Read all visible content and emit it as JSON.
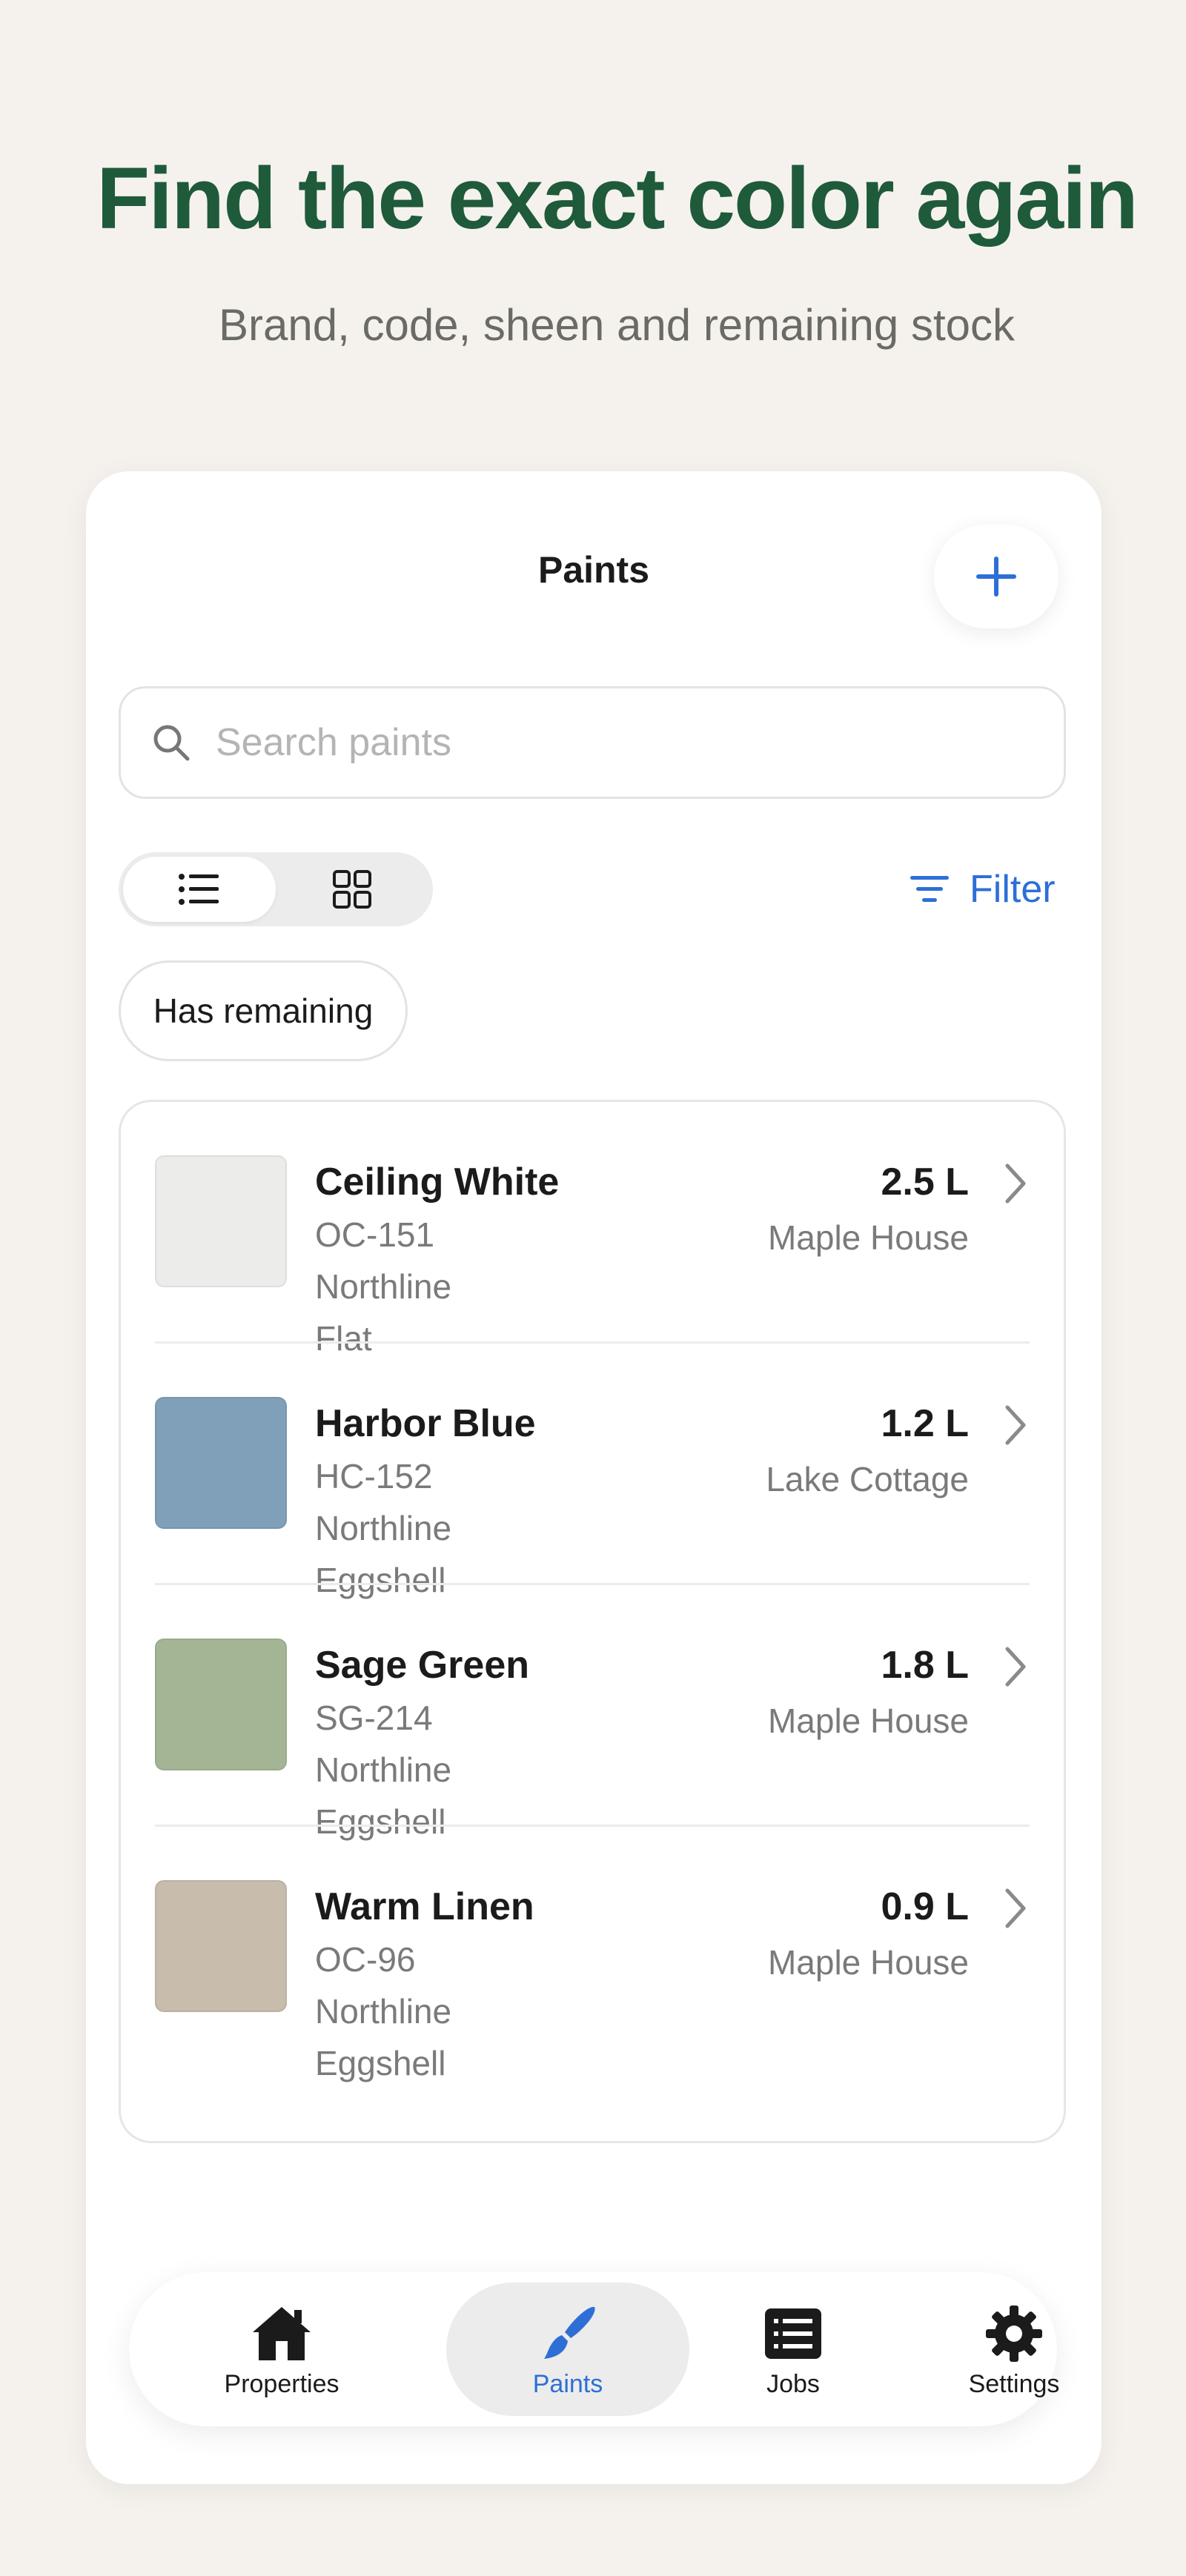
{
  "promo": {
    "headline": "Find the exact color again",
    "subhead": "Brand, code, sheen and remaining stock"
  },
  "header": {
    "title": "Paints",
    "add_icon": "plus-icon"
  },
  "search": {
    "placeholder": "Search paints",
    "value": ""
  },
  "view_toggle": {
    "options": [
      "list-view-icon",
      "grid-view-icon"
    ],
    "selected": "list-view-icon"
  },
  "filter": {
    "label": "Filter",
    "icon": "filter-lines-icon"
  },
  "chips": {
    "has_remaining": "Has remaining"
  },
  "paints": [
    {
      "name": "Ceiling White",
      "code": "OC-151",
      "brand": "Northline",
      "sheen": "Flat",
      "quantity": "2.5 L",
      "property": "Maple House",
      "swatch": "#ececea"
    },
    {
      "name": "Harbor Blue",
      "code": "HC-152",
      "brand": "Northline",
      "sheen": "Eggshell",
      "quantity": "1.2 L",
      "property": "Lake Cottage",
      "swatch": "#7fa0b8"
    },
    {
      "name": "Sage Green",
      "code": "SG-214",
      "brand": "Northline",
      "sheen": "Eggshell",
      "quantity": "1.8 L",
      "property": "Maple House",
      "swatch": "#a3b595"
    },
    {
      "name": "Warm Linen",
      "code": "OC-96",
      "brand": "Northline",
      "sheen": "Eggshell",
      "quantity": "0.9 L",
      "property": "Maple House",
      "swatch": "#c8bcad"
    }
  ],
  "tabs": [
    {
      "label": "Properties",
      "icon": "house-icon"
    },
    {
      "label": "Paints",
      "icon": "paintbrush-icon"
    },
    {
      "label": "Jobs",
      "icon": "list-icon"
    },
    {
      "label": "Settings",
      "icon": "gear-icon"
    }
  ],
  "colors": {
    "accent": "#2d6fd6",
    "headline": "#1f5a3b",
    "background": "#f5f2ee"
  }
}
